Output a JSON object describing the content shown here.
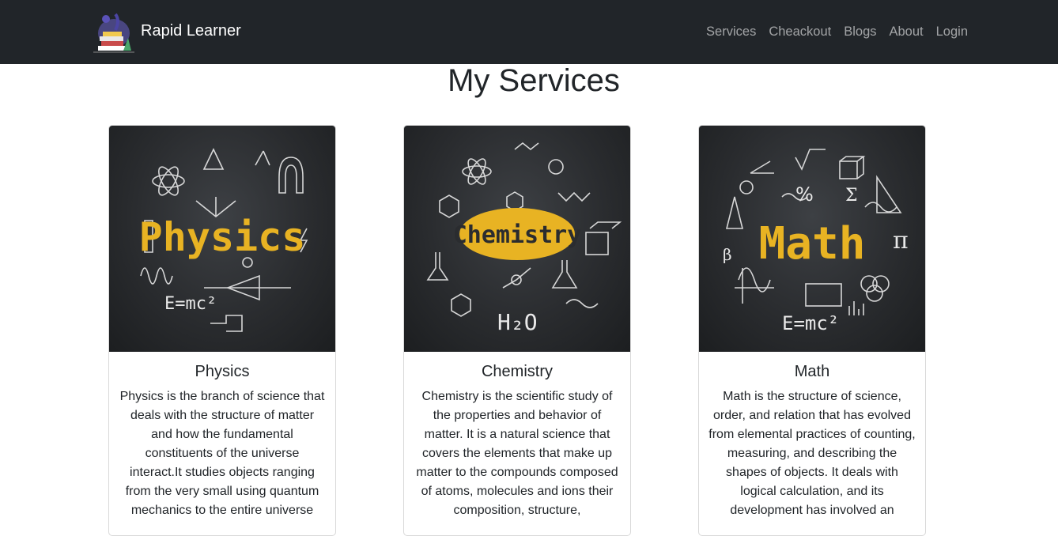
{
  "navbar": {
    "brand": "Rapid Learner",
    "links": [
      "Services",
      "Cheackout",
      "Blogs",
      "About",
      "Login"
    ]
  },
  "page_title": "My Services",
  "services": [
    {
      "title": "Physics",
      "image_word": "Physics",
      "description": "Physics is the branch of science that deals with the structure of matter and how the fundamental constituents of the universe interact.It studies objects ranging from the very small using quantum mechanics to the entire universe"
    },
    {
      "title": "Chemistry",
      "image_word": "Chemistry",
      "description": "Chemistry is the scientific study of the properties and behavior of matter. It is a natural science that covers the elements that make up matter to the compounds composed of atoms, molecules and ions their composition, structure,"
    },
    {
      "title": "Math",
      "image_word": "Math",
      "description": "Math is the structure of science, order, and relation that has evolved from elemental practices of counting, measuring, and describing the shapes of objects. It deals with logical calculation, and its development has involved an"
    }
  ],
  "colors": {
    "navbar_bg": "#212529",
    "chalk_yellow": "#e8b323",
    "chalk_white": "#e9e9e9"
  }
}
